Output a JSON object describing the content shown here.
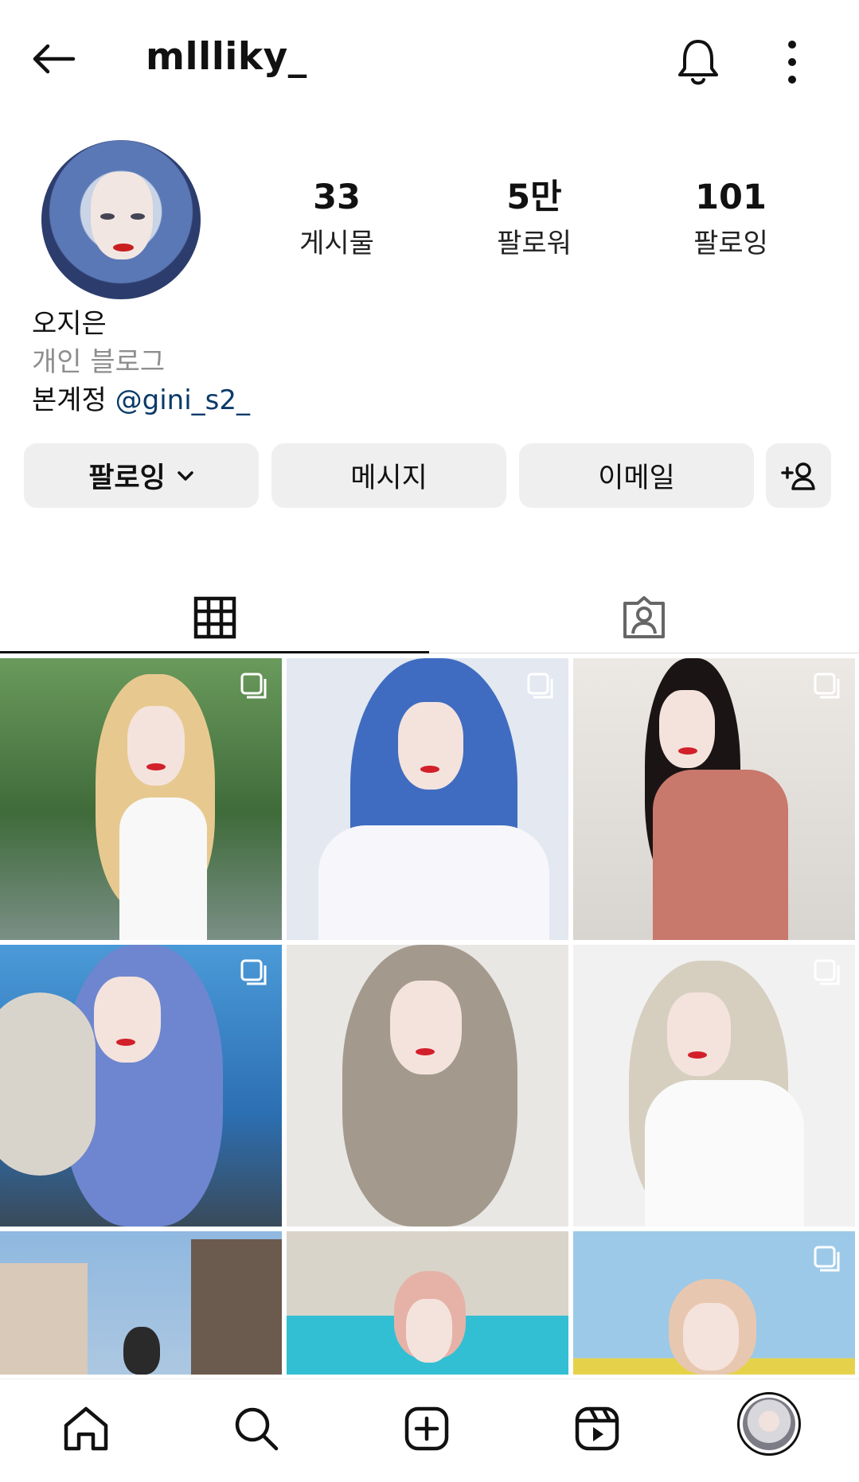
{
  "header": {
    "username": "mllliky_",
    "back_icon": "arrow-left-icon",
    "bell_icon": "bell-icon",
    "more_icon": "more-vertical-icon"
  },
  "profile": {
    "stats": [
      {
        "value": "33",
        "label": "게시물"
      },
      {
        "value": "5만",
        "label": "팔로워"
      },
      {
        "value": "101",
        "label": "팔로잉"
      }
    ],
    "name": "오지은",
    "category": "개인 블로그",
    "bio_prefix": "본계정",
    "bio_mention": "@gini_s2_"
  },
  "actions": {
    "following": "팔로잉",
    "message": "메시지",
    "email": "이메일"
  },
  "tabs": {
    "grid_icon": "grid-icon",
    "tagged_icon": "tagged-person-icon"
  },
  "grid": {
    "posts": [
      {
        "hair": "#e7c98f",
        "bg": "#5f8a52",
        "multi": true
      },
      {
        "hair": "#3f6cc0",
        "bg": "#dfe6f1",
        "multi": true
      },
      {
        "hair": "#1b1414",
        "bg": "#e9e6e2",
        "multi": true
      },
      {
        "hair": "#6d86cf",
        "bg": "#3c83c4",
        "multi": true
      },
      {
        "hair": "#a39a8d",
        "bg": "#e8e6e3",
        "multi": false
      },
      {
        "hair": "#d6cfc0",
        "bg": "#eeeeee",
        "multi": true
      },
      {
        "hair": "#2a2a2a",
        "bg": "#8fb3d9",
        "multi": false
      },
      {
        "hair": "#e6b2a7",
        "bg": "#33bfd3",
        "multi": false
      },
      {
        "hair": "#e8c7b0",
        "bg": "#9cc9e8",
        "multi": true
      }
    ]
  },
  "bottom_nav": [
    "home-icon",
    "search-icon",
    "create-icon",
    "reels-icon",
    "profile-avatar"
  ]
}
